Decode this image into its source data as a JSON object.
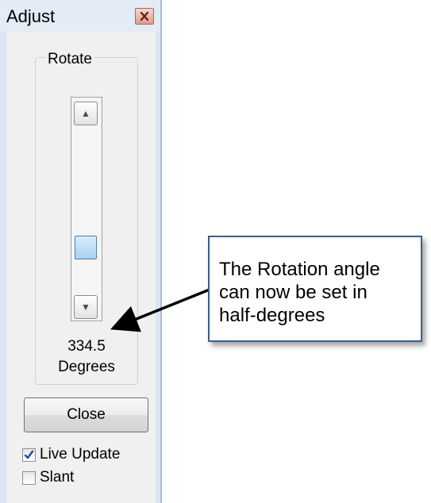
{
  "window": {
    "title": "Adjust",
    "close_icon": "close-x-icon"
  },
  "rotate_group": {
    "label": "Rotate",
    "up_arrow": "▲",
    "down_arrow": "▼",
    "slider_value": 334.5,
    "value_text": "334.5",
    "unit_text": "Degrees"
  },
  "buttons": {
    "close_label": "Close"
  },
  "options": {
    "live_update_label": "Live Update",
    "live_update_checked": true,
    "slant_label": "Slant",
    "slant_checked": false
  },
  "callout": {
    "line1": "The Rotation angle",
    "line2": "can now be set in",
    "line3": "half-degrees"
  },
  "colors": {
    "accent": "#3a5f8a",
    "close_red": "#d9867a",
    "thumb_blue": "#a9d1f2"
  }
}
